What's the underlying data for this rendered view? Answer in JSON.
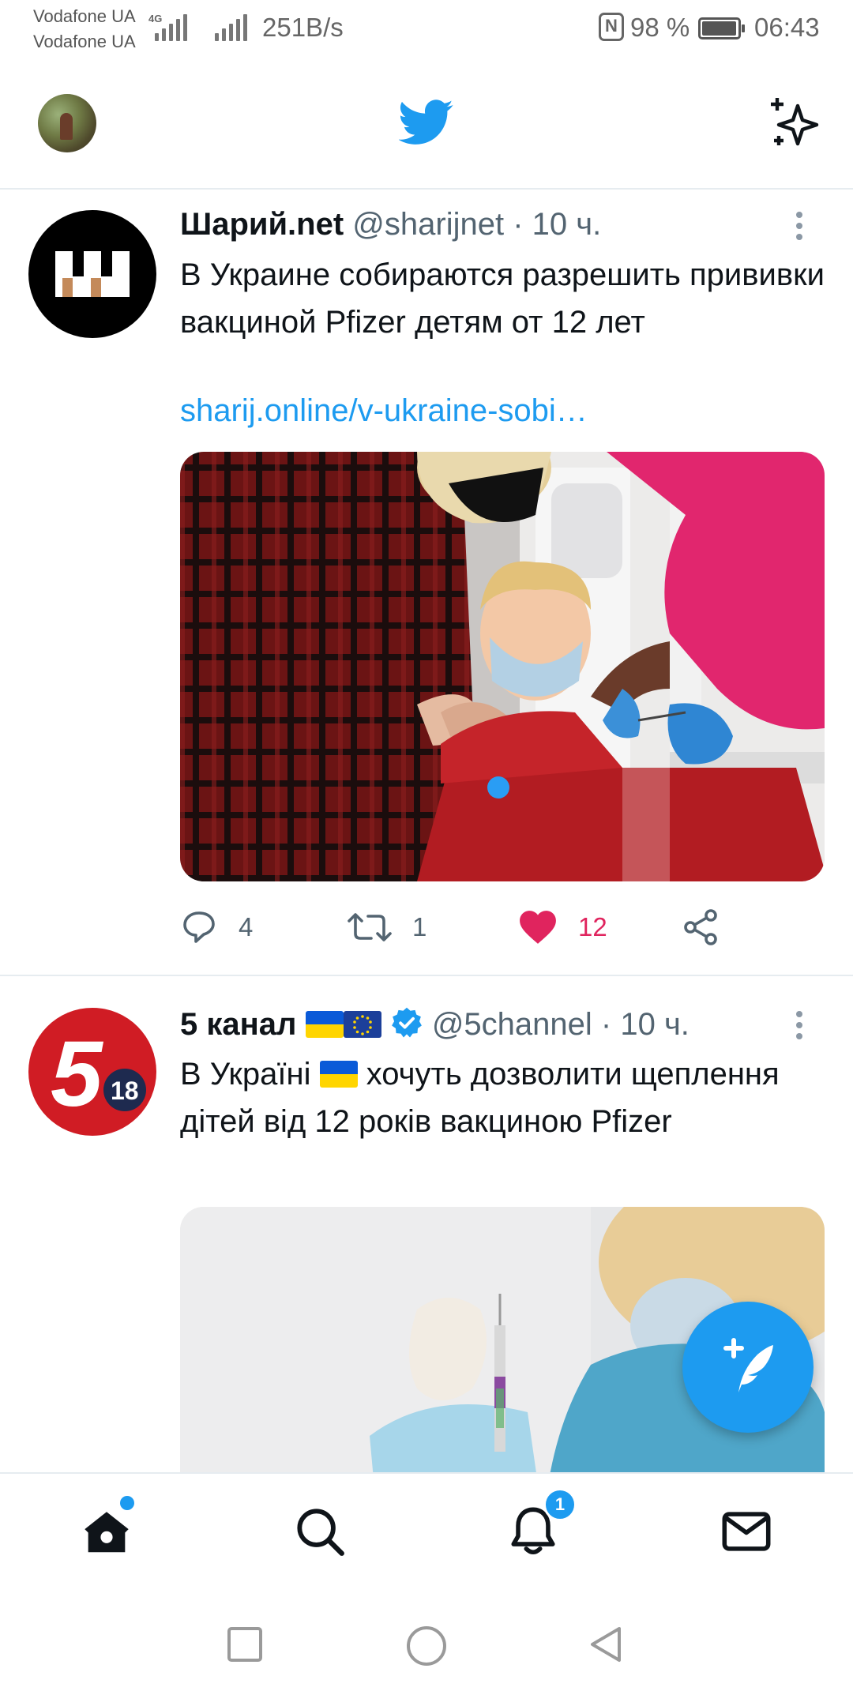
{
  "status_bar": {
    "carrier_1": "Vodafone UA",
    "carrier_2": "Vodafone UA",
    "network_type": "4G",
    "net_speed": "251B/s",
    "nfc_label": "N",
    "battery_percent": "98 %",
    "battery_level": 0.98,
    "time": "06:43"
  },
  "header": {
    "logo_icon": "twitter-bird-icon",
    "timeline_icon": "sparkle-icon"
  },
  "tweets": [
    {
      "display_name": "Шарий.net",
      "handle": "@sharijnet",
      "time_ago": "· 10 ч.",
      "text": "В Украине собираются разрешить прививки вакциной Pfizer детям от 12 лет",
      "link": "sharij.online/v-ukraine-sobi…",
      "replies": "4",
      "retweets": "1",
      "likes": "12",
      "liked": true
    },
    {
      "display_name": "5 канал",
      "handle": "@5channel",
      "time_ago": "· 10 ч.",
      "text_1": "В Україні",
      "text_2": "хочуть дозволити щеплення дітей від 12 років вакциною Pfizer",
      "verified": true,
      "avatar_number": "5",
      "avatar_badge": "18"
    }
  ],
  "tabbar": {
    "notifications_badge": "1"
  },
  "colors": {
    "accent": "#1d9bf0",
    "like": "#e0245e",
    "text_primary": "#0f1419",
    "text_secondary": "#536471"
  }
}
